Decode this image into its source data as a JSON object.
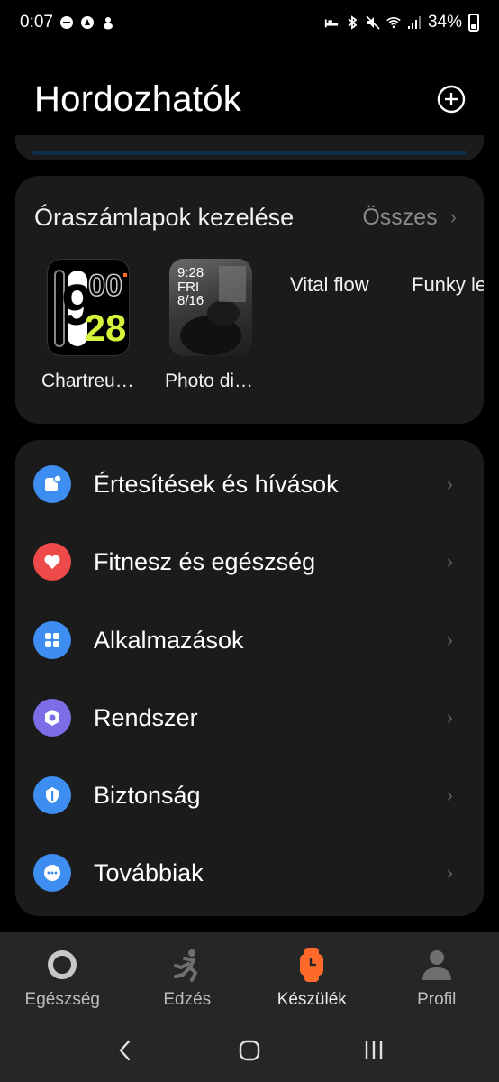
{
  "status_bar": {
    "time": "0:07",
    "battery": "34%"
  },
  "header": {
    "title": "Hordozhatók"
  },
  "watch_faces": {
    "title": "Óraszámlapok kezelése",
    "all_label": "Összes",
    "items": [
      {
        "label": "Chartreu…",
        "time_hour": "9",
        "time_min_top": "00",
        "time_min_bottom": "28"
      },
      {
        "label": "Photo di…",
        "time": "9:28",
        "day": "FRI",
        "date": "8/16"
      },
      {
        "label": "Vital flow"
      },
      {
        "label": "Funky le"
      }
    ]
  },
  "menu": {
    "items": [
      {
        "label": "Értesítések és hívások",
        "icon": "notification-icon",
        "color": "#3d8ef0"
      },
      {
        "label": "Fitnesz és egészség",
        "icon": "heart-icon",
        "color": "#ef4a4a"
      },
      {
        "label": "Alkalmazások",
        "icon": "apps-icon",
        "color": "#3d8ef0"
      },
      {
        "label": "Rendszer",
        "icon": "system-icon",
        "color": "#7b6ee6"
      },
      {
        "label": "Biztonság",
        "icon": "shield-icon",
        "color": "#3d8ef0"
      },
      {
        "label": "Továbbiak",
        "icon": "more-icon",
        "color": "#3d8ef0"
      }
    ]
  },
  "bottom_nav": {
    "tabs": [
      {
        "label": "Egészség",
        "icon": "ring-icon"
      },
      {
        "label": "Edzés",
        "icon": "runner-icon"
      },
      {
        "label": "Készülék",
        "icon": "watch-icon",
        "active": true,
        "color": "#ff6a2b"
      },
      {
        "label": "Profil",
        "icon": "person-icon"
      }
    ]
  },
  "system_nav": {
    "back": "back-icon",
    "home": "home-icon",
    "recents": "recents-icon"
  }
}
